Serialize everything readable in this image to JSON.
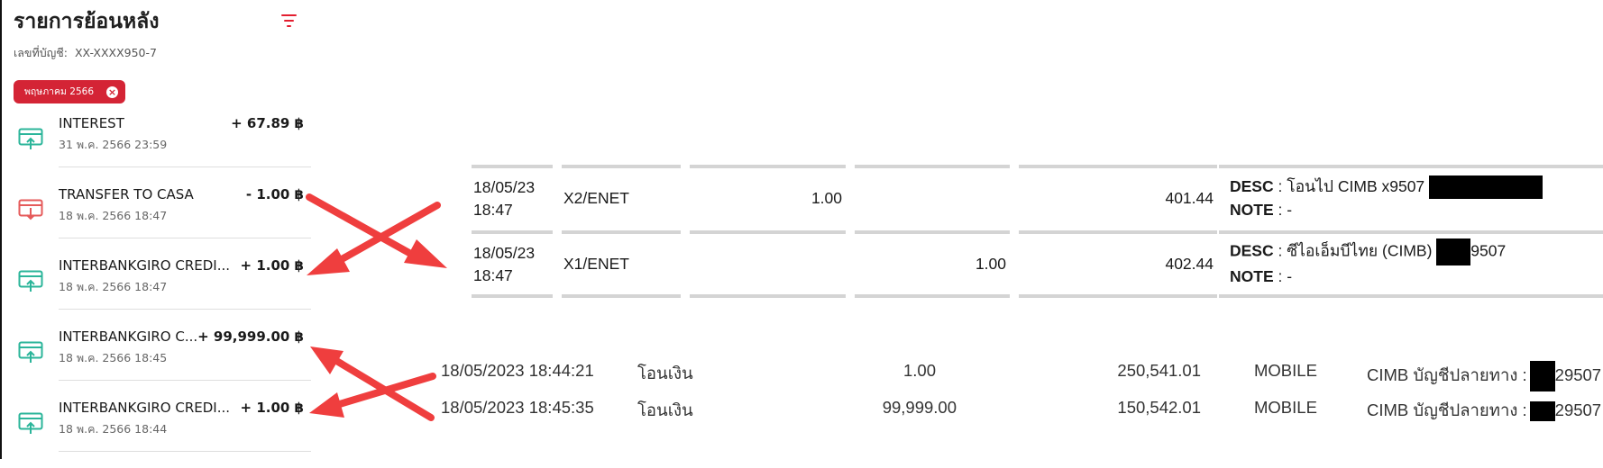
{
  "panel": {
    "title": "รายการย้อนหลัง",
    "account_label": "เลขที่บัญชี:",
    "account_number": "XX-XXXX950-7",
    "filter_chip": "พฤษภาคม 2566",
    "filter_icon": "filter-icon",
    "chip_close_icon": "close-icon"
  },
  "transactions": [
    {
      "name": "INTEREST",
      "date": "31 พ.ค. 2566 23:59",
      "amount": "+ 67.89 ฿",
      "icon": "incoming-tray-icon",
      "color": "#2bb59a"
    },
    {
      "name": "TRANSFER TO CASA",
      "date": "18 พ.ค. 2566 18:47",
      "amount": "- 1.00 ฿",
      "icon": "outgoing-tray-icon",
      "color": "#e55a5a"
    },
    {
      "name": "INTERBANKGIRO CREDI...",
      "date": "18 พ.ค. 2566 18:47",
      "amount": "+ 1.00 ฿",
      "icon": "incoming-tray-icon",
      "color": "#2bb59a"
    },
    {
      "name": "INTERBANKGIRO C...",
      "date": "18 พ.ค. 2566 18:45",
      "amount": "+ 99,999.00 ฿",
      "icon": "incoming-tray-icon",
      "color": "#2bb59a"
    },
    {
      "name": "INTERBANKGIRO CREDI...",
      "date": "18 พ.ค. 2566 18:44",
      "amount": "+ 1.00 ฿",
      "icon": "incoming-tray-icon",
      "color": "#2bb59a"
    }
  ],
  "statement1": {
    "rows": [
      {
        "date": "18/05/23",
        "time": "18:47",
        "code": "X2/ENET",
        "debit": "1.00",
        "credit": "",
        "balance": "401.44",
        "desc_label": "DESC",
        "desc_sep": " : ",
        "desc": "โอนไป CIMB x9507",
        "desc_suffix": "",
        "note_label": "NOTE",
        "note_sep": " : ",
        "note": "-"
      },
      {
        "date": "18/05/23",
        "time": "18:47",
        "code": "X1/ENET",
        "debit": "",
        "credit": "1.00",
        "balance": "402.44",
        "desc_label": "DESC",
        "desc_sep": " : ",
        "desc": "ซีไอเอ็มบีไทย (CIMB)",
        "desc_suffix": "9507",
        "note_label": "NOTE",
        "note_sep": " : ",
        "note": "-"
      }
    ]
  },
  "statement2": {
    "rows": [
      {
        "datetime": "18/05/2023 18:44:21",
        "type": "โอนเงิน",
        "amount": "1.00",
        "balance": "250,541.01",
        "channel": "MOBILE",
        "dest": "CIMB บัญชีปลายทาง :",
        "dest_suffix": "29507"
      },
      {
        "datetime": "18/05/2023 18:45:35",
        "type": "โอนเงิน",
        "amount": "99,999.00",
        "balance": "150,542.01",
        "channel": "MOBILE",
        "dest": "CIMB บัญชีปลายทาง :",
        "dest_suffix": "29507"
      }
    ]
  },
  "colors": {
    "brand_red": "#d42435",
    "arrow_red": "#ef3e3e",
    "in_green": "#2bb59a",
    "out_red": "#e55a5a"
  }
}
